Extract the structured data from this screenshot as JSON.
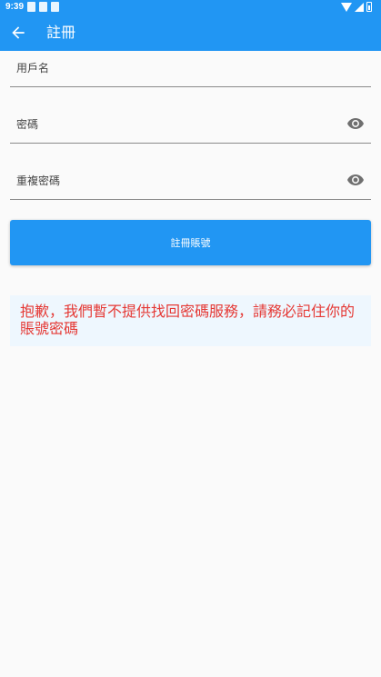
{
  "status_bar": {
    "time": "9:39"
  },
  "app_bar": {
    "title": "註冊",
    "back_icon": "arrow-back-icon"
  },
  "form": {
    "username": {
      "placeholder": "用戶名",
      "value": ""
    },
    "password": {
      "placeholder": "密碼",
      "value": "",
      "toggle_icon": "eye-icon"
    },
    "confirm_password": {
      "placeholder": "重複密碼",
      "value": "",
      "toggle_icon": "eye-icon"
    },
    "submit_label": "註冊賬號"
  },
  "notice": {
    "text": "抱歉，我們暫不提供找回密碼服務，請務必記住你的賬號密碼"
  },
  "colors": {
    "primary": "#2196f3",
    "notice_background": "#eef7fe",
    "notice_text": "#e53935",
    "page_background": "#fafafa"
  }
}
